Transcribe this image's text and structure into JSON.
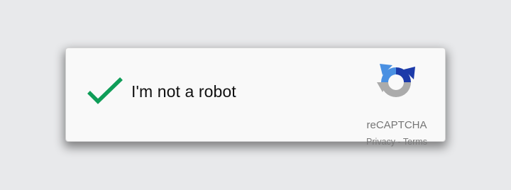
{
  "checkbox": {
    "label": "I'm not a robot",
    "checked": true,
    "check_color": "#0f9d58"
  },
  "brand": {
    "name": "reCAPTCHA",
    "logo_icon": "recaptcha-logo-icon",
    "privacy_label": "Privacy",
    "separator": " - ",
    "terms_label": "Terms"
  },
  "colors": {
    "background": "#e8e9eb",
    "widget_background": "#f9f9f9",
    "logo_blue": "#1c3aa9",
    "logo_light_blue": "#4a90e2",
    "logo_gray": "#ababab"
  }
}
